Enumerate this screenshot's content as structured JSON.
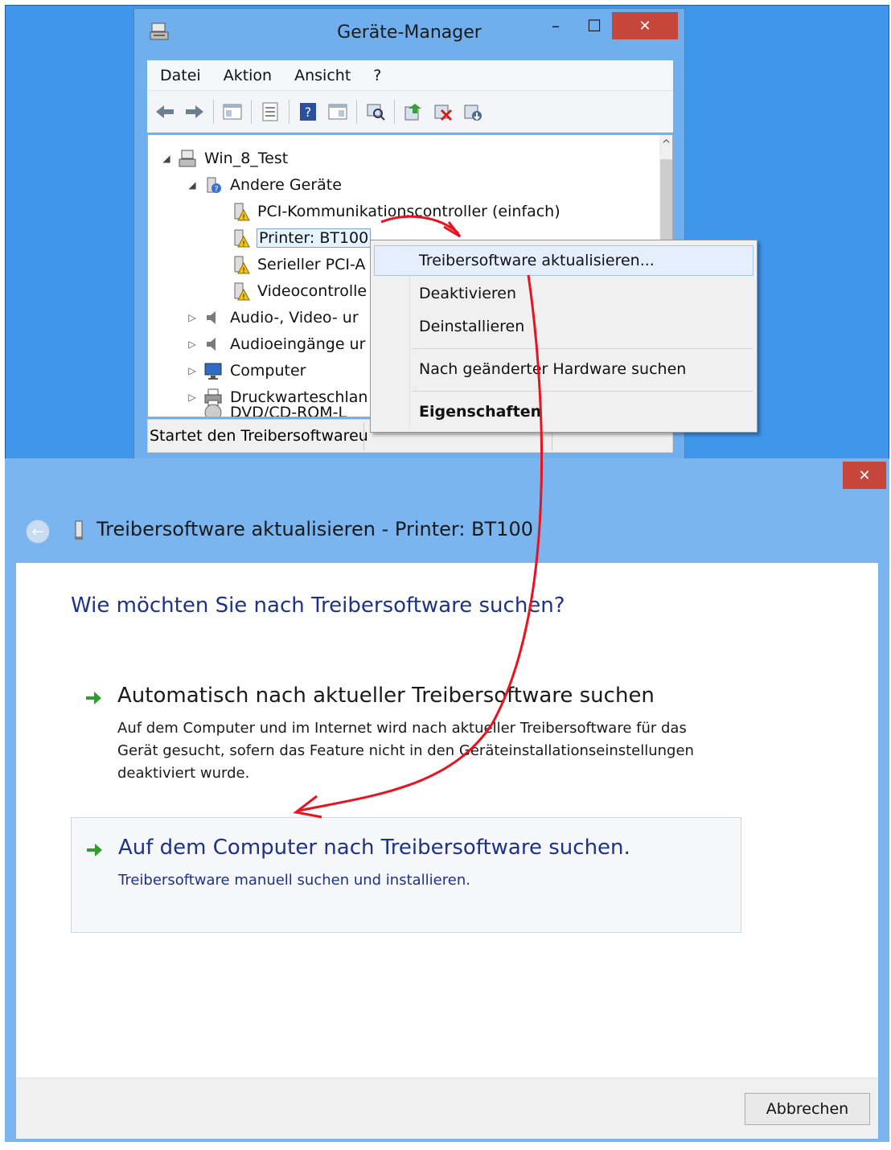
{
  "device_manager": {
    "title": "Geräte-Manager",
    "window_buttons": {
      "minimize": "–",
      "maximize": "☐",
      "close": "✕"
    },
    "menu": [
      "Datei",
      "Aktion",
      "Ansicht",
      "?"
    ],
    "tree": {
      "root": "Win_8_Test",
      "items": [
        {
          "label": "Andere Geräte",
          "expander": "◢"
        },
        {
          "label": "PCI-Kommunikationscontroller (einfach)"
        },
        {
          "label": "Printer: BT100",
          "selected": true
        },
        {
          "label": "Serieller PCI-A"
        },
        {
          "label": "Videocontrolle"
        },
        {
          "label": "Audio-, Video- ur",
          "expander": "▷"
        },
        {
          "label": "Audioeingänge ur",
          "expander": "▷"
        },
        {
          "label": "Computer",
          "expander": "▷"
        },
        {
          "label": "Druckwarteschlan",
          "expander": "▷"
        },
        {
          "label": "DVD/CD-ROM-L"
        }
      ],
      "root_expander": "◢"
    },
    "status_text": "Startet den Treibersoftwareu"
  },
  "context_menu": {
    "items": [
      {
        "label": "Treibersoftware aktualisieren...",
        "highlighted": true
      },
      {
        "label": "Deaktivieren"
      },
      {
        "label": "Deinstallieren"
      },
      {
        "label": "Nach geänderter Hardware suchen"
      },
      {
        "label": "Eigenschaften",
        "bold": true
      }
    ]
  },
  "wizard": {
    "close": "✕",
    "back": "←",
    "title": "Treibersoftware aktualisieren - Printer: BT100",
    "question": "Wie möchten Sie nach Treibersoftware suchen?",
    "options": [
      {
        "title": "Automatisch nach aktueller Treibersoftware suchen",
        "description": "Auf dem Computer und im Internet wird nach aktueller Treibersoftware für das Gerät gesucht, sofern das Feature nicht in den Geräteinstallationseinstellungen deaktiviert wurde."
      },
      {
        "title": "Auf dem Computer nach Treibersoftware suchen.",
        "description": "Treibersoftware manuell suchen und installieren."
      }
    ],
    "cancel_label": "Abbrechen"
  },
  "colors": {
    "desktop_blue": "#3f96ea",
    "link_blue": "#1e3287",
    "close_red": "#c7463c",
    "annotation_red": "#e8131f",
    "arrow_green": "#2e9e2e"
  }
}
